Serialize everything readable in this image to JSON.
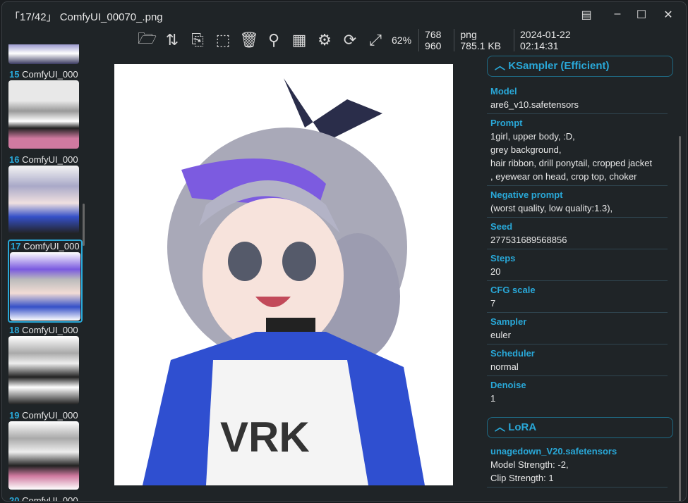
{
  "window": {
    "title": "「17/42」 ComfyUI_00070_.png"
  },
  "toolbar": {
    "zoom": "62%",
    "width": "768",
    "height": "960",
    "format": "png",
    "size": "785.1 KB",
    "date": "2024-01-22",
    "time": "02:14:31"
  },
  "thumbnails": [
    {
      "num": "15",
      "name": "ComfyUI_000"
    },
    {
      "num": "16",
      "name": "ComfyUI_000"
    },
    {
      "num": "17",
      "name": "ComfyUI_000"
    },
    {
      "num": "18",
      "name": "ComfyUI_000"
    },
    {
      "num": "19",
      "name": "ComfyUI_000"
    },
    {
      "num": "20",
      "name": "ComfyUI_000"
    }
  ],
  "ksampler": {
    "title": "KSampler (Efficient)",
    "fields": [
      {
        "label": "Model",
        "value": "are6_v10.safetensors"
      },
      {
        "label": "Prompt",
        "value": "1girl, upper body, :D,\ngrey background,\nhair ribbon, drill ponytail, cropped jacket\n, eyewear on head, crop top, choker"
      },
      {
        "label": "Negative prompt",
        "value": "(worst quality, low quality:1.3),"
      },
      {
        "label": "Seed",
        "value": "277531689568856"
      },
      {
        "label": "Steps",
        "value": "20"
      },
      {
        "label": "CFG scale",
        "value": "7"
      },
      {
        "label": "Sampler",
        "value": "euler"
      },
      {
        "label": "Scheduler",
        "value": "normal"
      },
      {
        "label": "Denoise",
        "value": "1"
      }
    ]
  },
  "lora": {
    "title": "LoRA",
    "name": "unagedown_V20.safetensors",
    "model_strength": "Model Strength: -2,",
    "clip_strength": "Clip Strength: 1"
  },
  "colors": {
    "accent": "#29a8d8",
    "background": "#1f2427"
  }
}
